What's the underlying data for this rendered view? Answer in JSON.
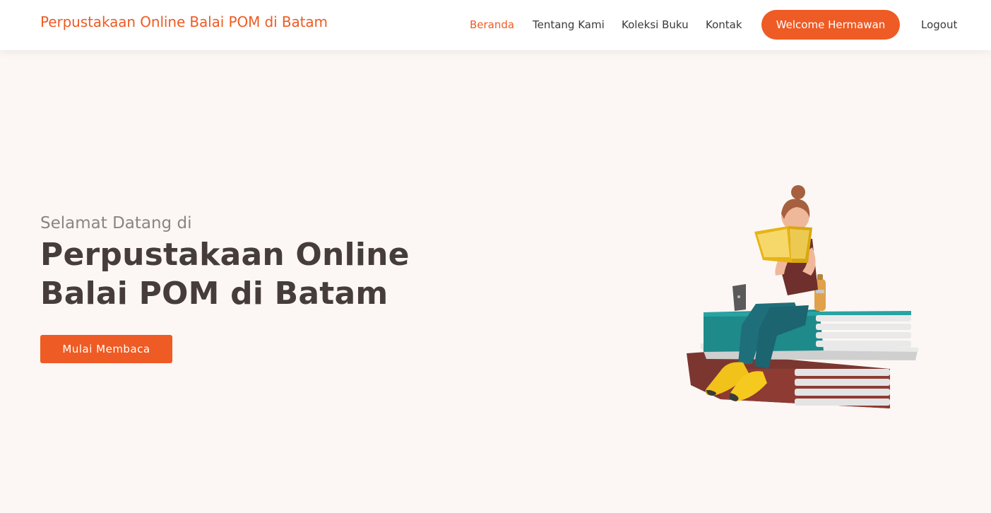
{
  "brand": "Perpustakaan Online Balai POM di Batam",
  "nav": {
    "links": [
      "Beranda",
      "Tentang Kami",
      "Koleksi Buku",
      "Kontak"
    ],
    "active": "Beranda",
    "welcome_label": "Welcome Hermawan",
    "logout_label": "Logout"
  },
  "hero": {
    "subtitle": "Selamat Datang di",
    "title": "Perpustakaan Online Balai POM di Batam",
    "cta_label": "Mulai Membaca",
    "illustration": "woman-reading-on-books-illustration"
  },
  "colors": {
    "accent": "#ee5b24",
    "background": "#fcf7f4",
    "heading": "#463d3a",
    "subtitle": "#8c8480",
    "nav_text": "#3a3a3a"
  }
}
